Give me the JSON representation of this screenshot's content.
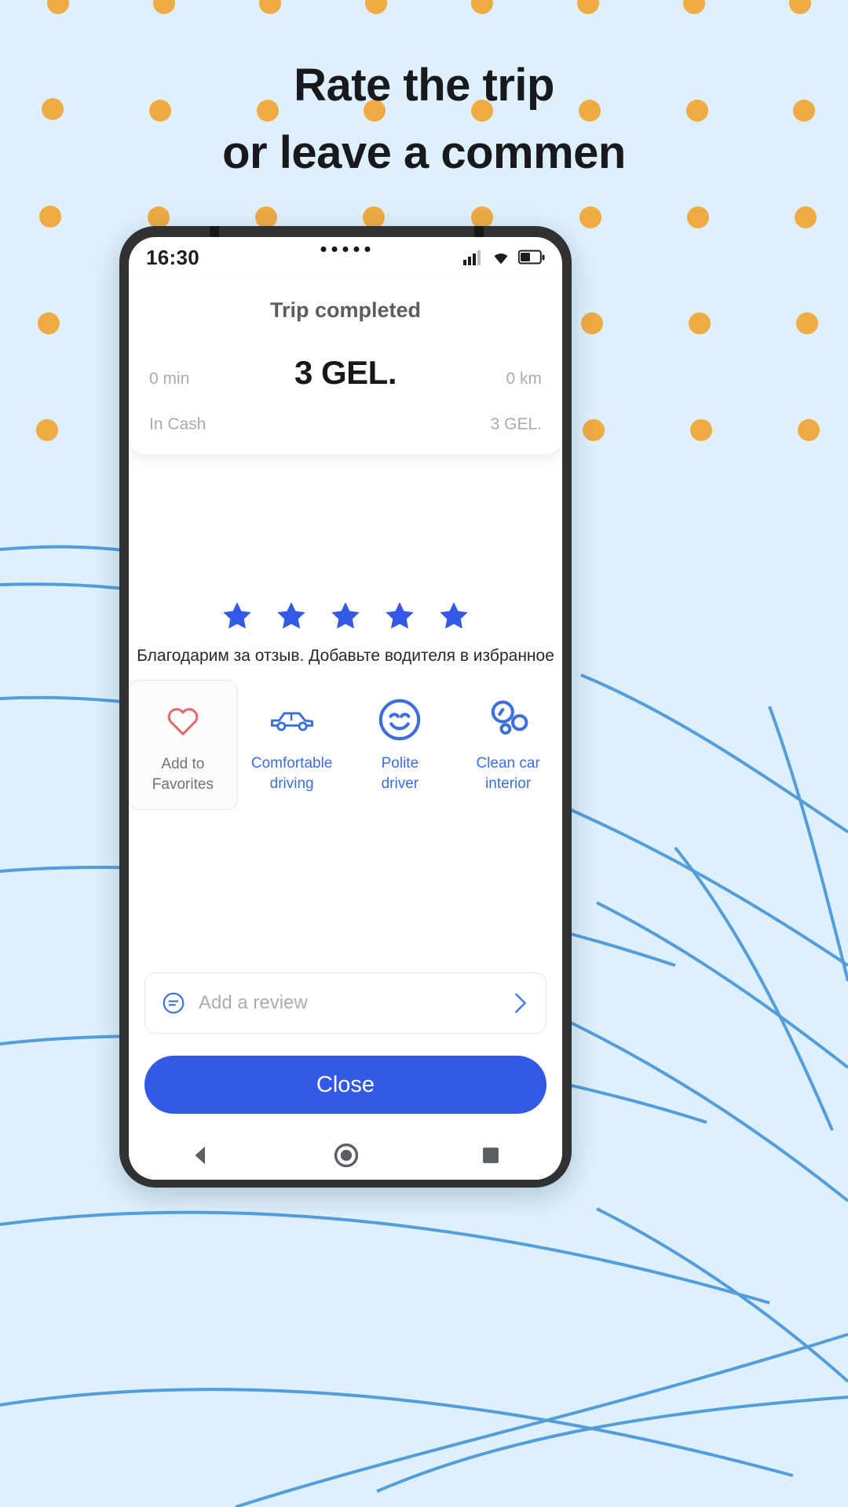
{
  "page": {
    "background_color": "#ddf0fb",
    "dot_color": "#eeab43",
    "line_color": "#3d8fd6"
  },
  "headline": {
    "line1": "Rate the trip",
    "line2": "or leave a commen"
  },
  "phone": {
    "status_bar": {
      "time": "16:30",
      "dots_icon": "five-dots-icon",
      "signal_icon": "cellular-signal-icon",
      "wifi_icon": "wifi-icon",
      "battery_icon": "battery-icon"
    },
    "trip_card": {
      "title": "Trip completed",
      "duration": "0 min",
      "amount": "3 GEL.",
      "distance": "0 km",
      "payment_method": "In Cash",
      "payment_amount": "3 GEL."
    },
    "rating": {
      "star_icon": "star-icon",
      "star_count": 5,
      "filled": 5,
      "star_color": "#3459e6",
      "thanks_text": "Благодарим за отзыв. Добавьте водителя в избранное"
    },
    "tiles": [
      {
        "icon": "heart-icon",
        "label": "Add to\nFavorites",
        "label_line1": "Add to",
        "label_line2": "Favorites",
        "color": "#e06c6c",
        "selected": true
      },
      {
        "icon": "car-icon",
        "label_line1": "Comfortable",
        "label_line2": "driving",
        "color": "#3b6fe0",
        "selected": false
      },
      {
        "icon": "smiley-icon",
        "label_line1": "Polite",
        "label_line2": "driver",
        "color": "#3b6fe0",
        "selected": false
      },
      {
        "icon": "bubbles-icon",
        "label_line1": "Clean car",
        "label_line2": "interior",
        "color": "#3b6fe0",
        "selected": false
      }
    ],
    "review": {
      "icon": "message-icon",
      "placeholder": "Add a review",
      "chevron_icon": "chevron-right-icon"
    },
    "close_button": {
      "label": "Close",
      "color": "#3459e6"
    },
    "nav_bar": {
      "back_icon": "back-triangle-icon",
      "home_icon": "home-circle-icon",
      "recents_icon": "recents-square-icon"
    }
  }
}
